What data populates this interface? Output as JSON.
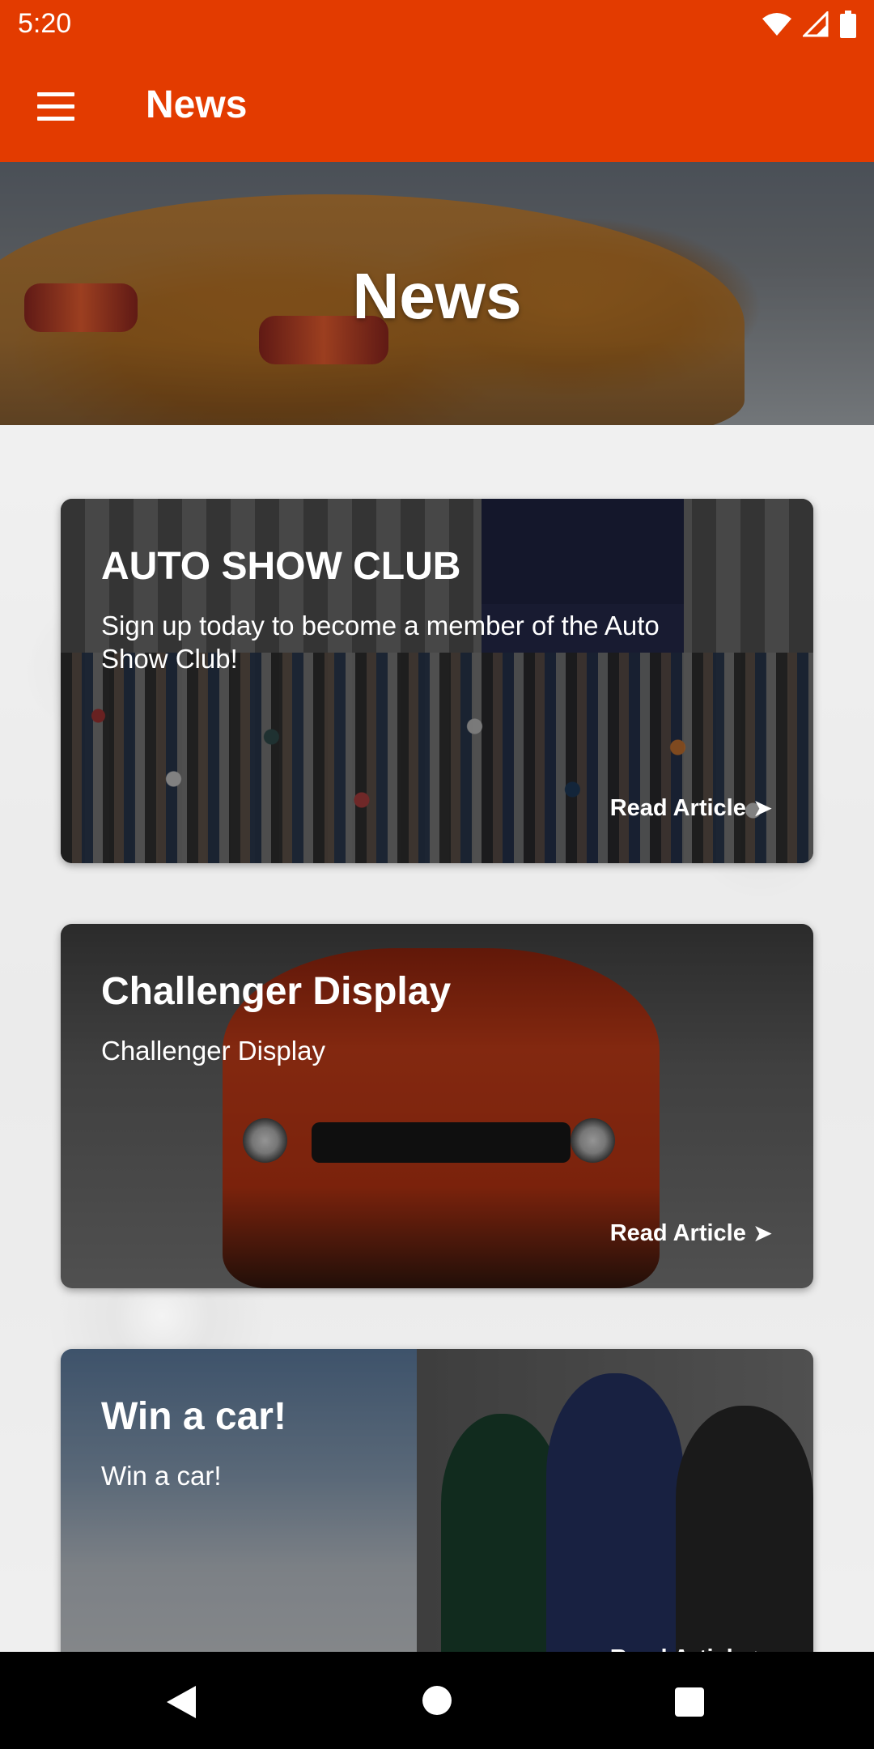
{
  "status_bar": {
    "time": "5:20",
    "icons": [
      "wifi-icon",
      "signal-icon",
      "battery-icon"
    ]
  },
  "app_bar": {
    "title": "News",
    "menu_icon": "hamburger-menu-icon"
  },
  "hero": {
    "title": "News"
  },
  "articles": [
    {
      "title": "AUTO SHOW CLUB",
      "description": "Sign up today to become a member of the Auto Show Club!",
      "read_label": "Read Article",
      "arrow": "➤"
    },
    {
      "title": "Challenger Display",
      "description": "Challenger Display",
      "read_label": "Read Article",
      "arrow": "➤"
    },
    {
      "title": "Win a car!",
      "description": "Win a car!",
      "read_label": "Read Article",
      "arrow": "➤"
    }
  ],
  "nav_bar": {
    "back_icon": "back-icon",
    "home_icon": "home-icon",
    "recents_icon": "recents-icon"
  },
  "colors": {
    "accent": "#e33b00",
    "nav_bar": "#000000"
  }
}
